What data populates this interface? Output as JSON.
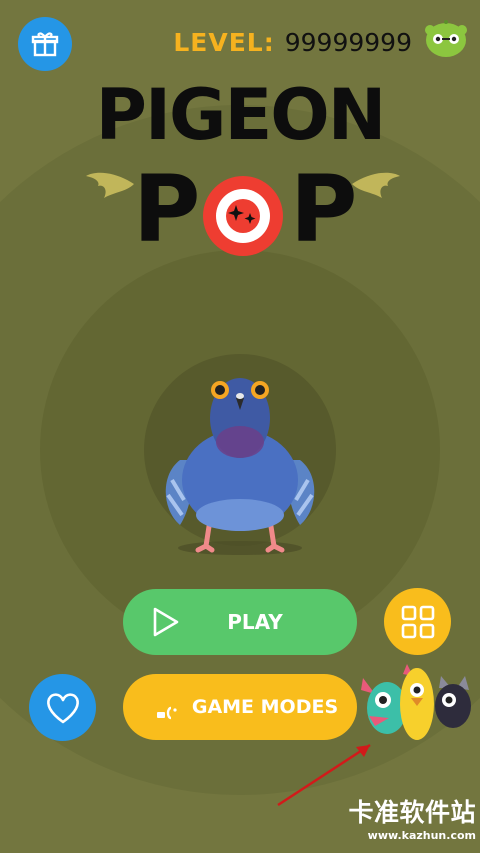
{
  "header": {
    "level_label": "LEVEL:",
    "level_value": "99999999",
    "gift_icon": "gift-icon",
    "mascot_icon": "green-bug-icon"
  },
  "title": {
    "line1": "PIGEON",
    "line2": "POP"
  },
  "buttons": {
    "play_label": "PLAY",
    "game_modes_label": "GAME MODES",
    "grid_icon": "grid-icon",
    "heart_icon": "heart-icon"
  },
  "watermark": {
    "text": "卡准软件站",
    "url": "www.kazhun.com"
  },
  "colors": {
    "background": "#73763f",
    "play": "#58c86b",
    "accent_yellow": "#f9bd1c",
    "accent_blue": "#2596e6",
    "logo_red": "#ee3d31"
  }
}
